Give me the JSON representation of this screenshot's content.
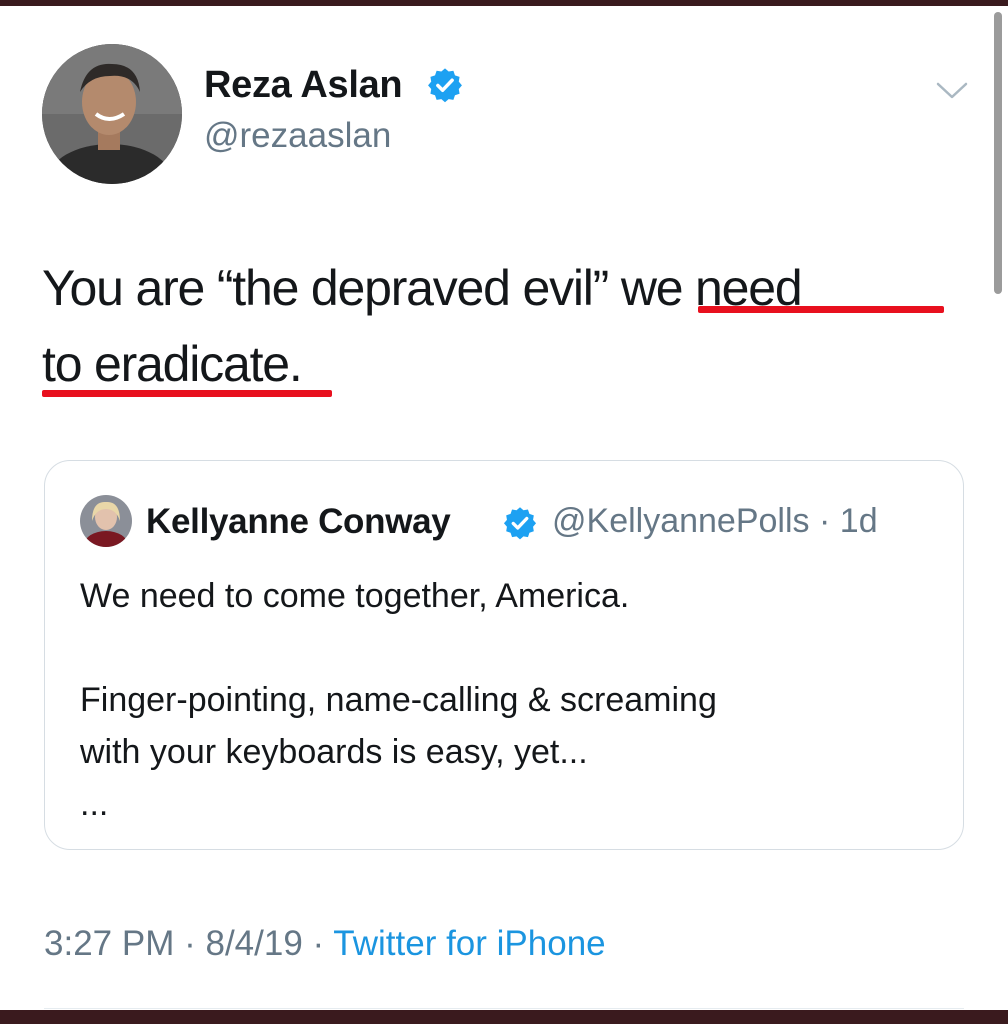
{
  "author": {
    "name": "Reza Aslan",
    "handle": "@rezaaslan",
    "verified_icon": "verified-badge-icon",
    "avatar_icon": "author-avatar"
  },
  "tweet": {
    "text_plain": "You are “the depraved evil” ",
    "text_underlined_1": "we need",
    "text_underlined_2": "to eradicate",
    "text_end": ".",
    "underline_color": "#e8101e"
  },
  "quoted": {
    "name": "Kellyanne Conway",
    "handle": "@KellyannePolls",
    "age": "1d",
    "body": "We need to come together, America.\n\nFinger-pointing, name-calling & screaming\nwith your keyboards is easy, yet...\n..."
  },
  "meta": {
    "time": "3:27 PM",
    "date": "8/4/19",
    "source": "Twitter for iPhone",
    "sep": "·"
  },
  "colors": {
    "link_blue": "#1b95e0",
    "verified_blue": "#1da1f2",
    "frame": "#3a1a1e"
  }
}
